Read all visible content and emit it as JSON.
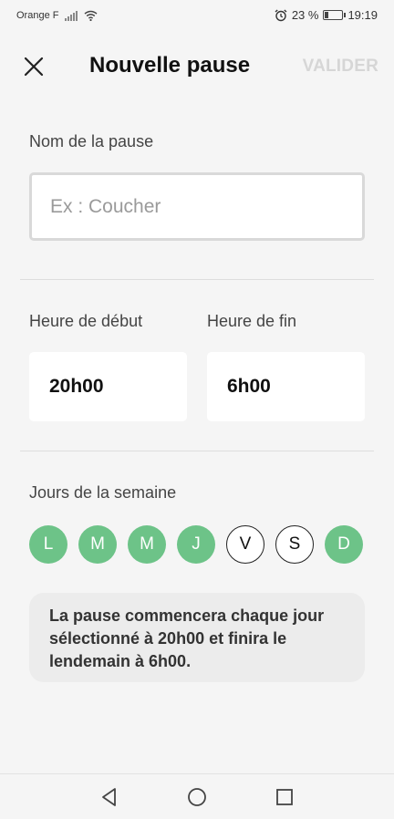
{
  "status_bar": {
    "carrier": "Orange F",
    "battery_percent": "23 %",
    "battery_level": 0.23,
    "time": "19:19"
  },
  "header": {
    "title": "Nouvelle pause",
    "validate_label": "VALIDER",
    "close_icon": "close-icon"
  },
  "form": {
    "name_label": "Nom de la pause",
    "name_placeholder": "Ex : Coucher",
    "name_value": "",
    "start_label": "Heure de début",
    "start_value": "20h00",
    "end_label": "Heure de fin",
    "end_value": "6h00",
    "days_label": "Jours de la semaine",
    "days": [
      {
        "label": "L",
        "selected": true
      },
      {
        "label": "M",
        "selected": true
      },
      {
        "label": "M",
        "selected": true
      },
      {
        "label": "J",
        "selected": true
      },
      {
        "label": "V",
        "selected": false
      },
      {
        "label": "S",
        "selected": false
      },
      {
        "label": "D",
        "selected": true
      }
    ],
    "summary": "La pause commencera chaque jour sélectionné à 20h00 et finira le lendemain à 6h00."
  },
  "colors": {
    "accent_green": "#6dc388",
    "disabled_text": "#d6d6d6"
  },
  "nav_bar": {
    "icons": [
      "back-triangle-icon",
      "home-circle-icon",
      "recents-square-icon"
    ]
  }
}
